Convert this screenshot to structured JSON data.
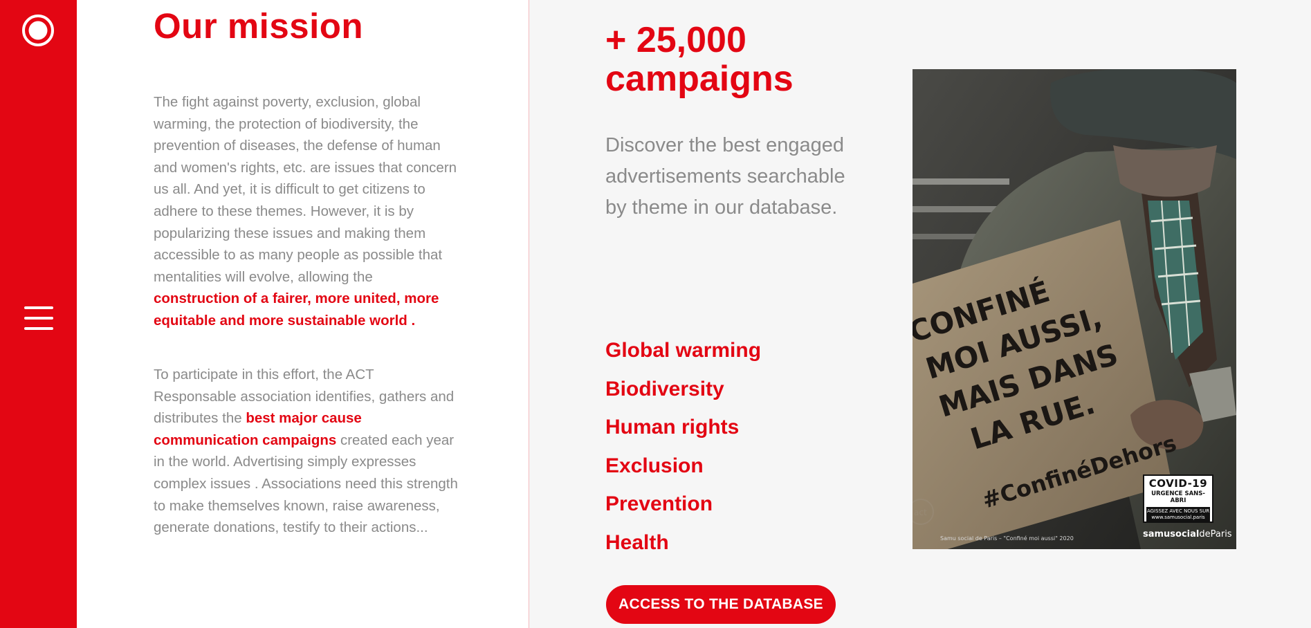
{
  "sidebar": {
    "logo_icon": "ring-logo-icon",
    "menu_icon": "hamburger-menu-icon",
    "background_color": "#e30613"
  },
  "mission": {
    "title": "Our mission",
    "paragraph1": {
      "text": "The fight against poverty, exclusion, global warming, the protection of biodiversity, the prevention of diseases, the defense of human and women's rights, etc. are issues that concern us all. And yet, it is difficult to get citizens to adhere to these themes. However, it is by popularizing these issues and making them accessible to as many people as possible that mentalities will evolve, allowing the ",
      "highlight": "construction of a fairer, more united, more equitable and more sustainable world ."
    },
    "paragraph2": {
      "text_before": "To participate in this effort, the ACT Responsable association identifies, gathers and distributes the ",
      "highlight": "best major cause communication campaigns",
      "text_after": " created each year in the world. Advertising simply expresses complex issues . Associations need this strength to make themselves known, raise awareness, generate donations, testify to their actions..."
    }
  },
  "database": {
    "count_line1": "+ 25,000",
    "count_line2": "campaigns",
    "description": "Discover the best engaged advertisements searchable by theme in our database.",
    "themes": [
      "Global warming",
      "Biodiversity",
      "Human rights",
      "Exclusion",
      "Prevention",
      "Health"
    ],
    "cta_label": "ACCESS TO THE DATABASE"
  },
  "poster": {
    "sign_lines": [
      "CONFINÉ",
      "MOI AUSSI,",
      "MAIS DANS",
      "LA RUE."
    ],
    "hashtag": "#ConfinéDehors",
    "badge_title": "COVID-19",
    "badge_subtitle": "URGENCE SANS-ABRI",
    "badge_line1": "AGISSEZ AVEC NOUS SUR",
    "badge_line2": "www.samusocial.paris",
    "caption": "Samu social de Paris – \"Confiné moi aussi\" 2020",
    "brand_bold": "samusocial",
    "brand_rest": "deParis",
    "act_mark": "act"
  },
  "colors": {
    "accent": "#e30613",
    "body_text": "#8a8a8a",
    "right_panel_bg": "#f6f6f6"
  }
}
